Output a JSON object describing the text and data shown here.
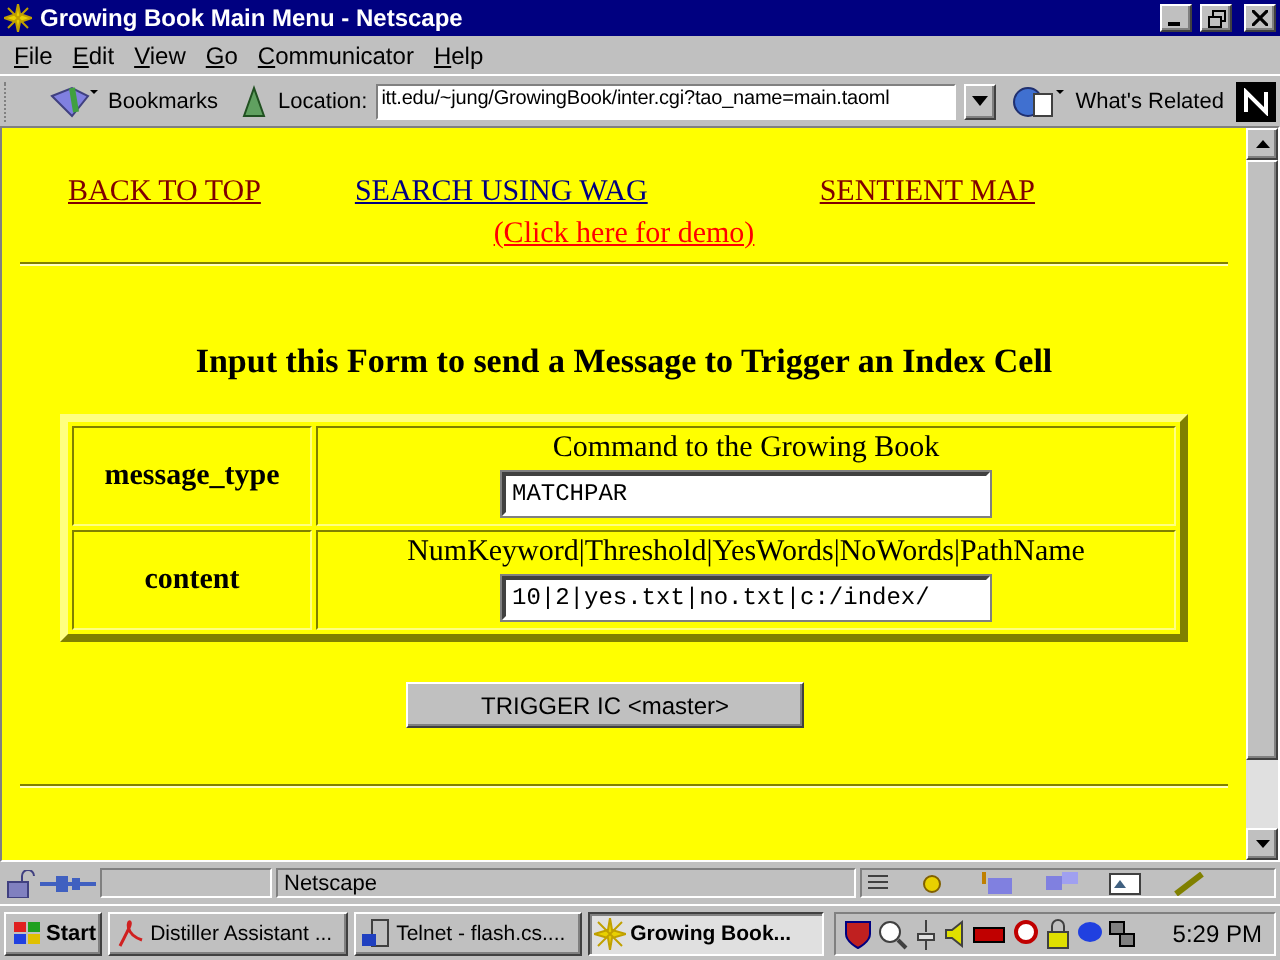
{
  "window": {
    "title": "Growing Book Main Menu - Netscape"
  },
  "menu": [
    "File",
    "Edit",
    "View",
    "Go",
    "Communicator",
    "Help"
  ],
  "toolbar": {
    "bookmarks": "Bookmarks",
    "location_label": "Location:",
    "location": "itt.edu/~jung/GrowingBook/inter.cgi?tao_name=main.taoml",
    "related": "What's Related"
  },
  "nav_links": [
    {
      "text": "BACK TO TOP",
      "color": "#800000"
    },
    {
      "text": "SEARCH USING WAG",
      "color": "#000080"
    },
    {
      "text": "SENTIENT MAP",
      "color": "#800000"
    }
  ],
  "demo_link": {
    "text": "(Click here for demo)",
    "color": "#ff0000"
  },
  "form": {
    "heading": "Input this Form to send a Message to Trigger an Index Cell",
    "rows": [
      {
        "label": "message_type",
        "caption": "Command to the Growing Book",
        "value": "MATCHPAR"
      },
      {
        "label": "content",
        "caption": "NumKeyword|Threshold|YesWords|NoWords|PathName",
        "value": "10|2|yes.txt|no.txt|c:/index/"
      }
    ],
    "button": "TRIGGER IC <master>"
  },
  "status_bar": {
    "text": "Netscape"
  },
  "taskbar": {
    "start": "Start",
    "tasks": [
      {
        "label": "Distiller Assistant ...",
        "selected": false
      },
      {
        "label": "Telnet - flash.cs....",
        "selected": false
      },
      {
        "label": "Growing Book...",
        "selected": true
      }
    ],
    "clock": "5:29 PM"
  }
}
